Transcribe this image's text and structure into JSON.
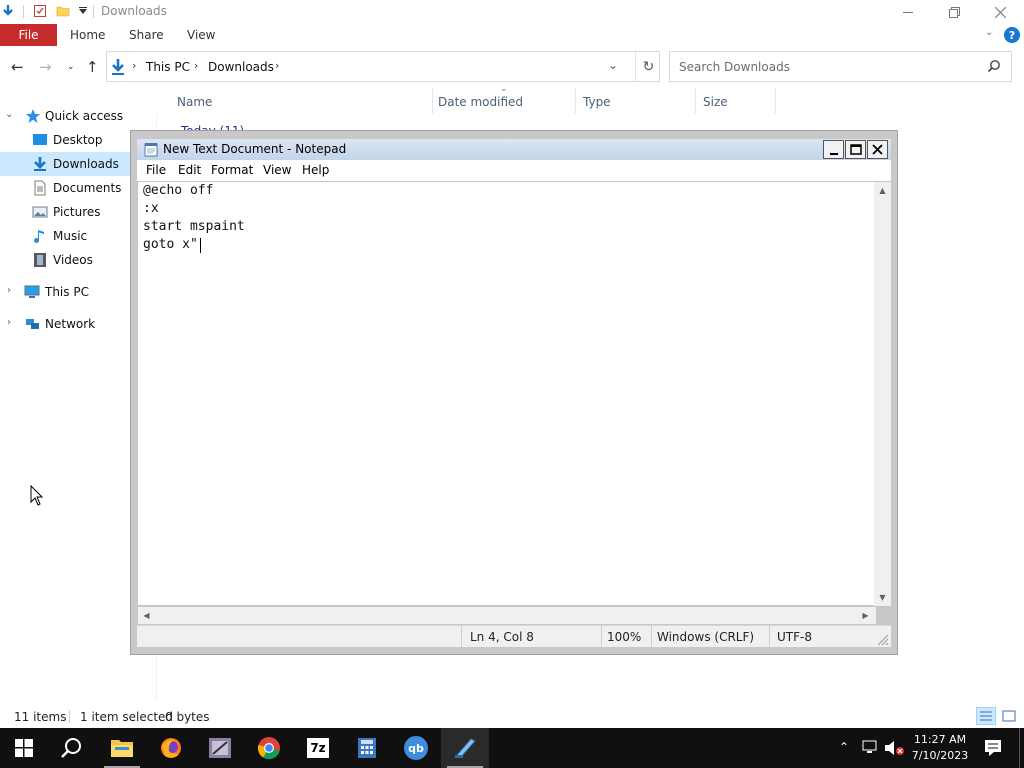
{
  "explorer": {
    "title": "Downloads",
    "ribbon": {
      "file": "File",
      "home": "Home",
      "share": "Share",
      "view": "View"
    },
    "address": {
      "this_pc": "This PC",
      "downloads": "Downloads"
    },
    "search_placeholder": "Search Downloads",
    "nav": {
      "quick_access": "Quick access",
      "desktop": "Desktop",
      "downloads": "Downloads",
      "documents": "Documents",
      "pictures": "Pictures",
      "music": "Music",
      "videos": "Videos",
      "this_pc": "This PC",
      "network": "Network"
    },
    "columns": {
      "name": "Name",
      "date_modified": "Date modified",
      "type": "Type",
      "size": "Size"
    },
    "group_header": "Today (11)",
    "status": {
      "items": "11 items",
      "selected": "1 item selected",
      "bytes": "0 bytes"
    }
  },
  "notepad": {
    "title": "New Text Document - Notepad",
    "menu": {
      "file": "File",
      "edit": "Edit",
      "format": "Format",
      "view": "View",
      "help": "Help"
    },
    "lines": [
      "@echo off",
      ":x",
      "start mspaint",
      "goto x\""
    ],
    "status": {
      "position": "Ln 4, Col 8",
      "zoom": "100%",
      "line_ending": "Windows (CRLF)",
      "encoding": "UTF-8"
    }
  },
  "taskbar": {
    "time": "11:27 AM",
    "date": "7/10/2023",
    "apps": [
      "start-icon",
      "search-icon",
      "file-explorer-icon",
      "firefox-icon",
      "winrar-icon",
      "chrome-icon",
      "7zip-icon",
      "calculator-icon",
      "qbittorrent-icon",
      "notepad-icon"
    ],
    "labels": {
      "sevenzip": "7z",
      "qbittorrent": "qb"
    }
  },
  "colors": {
    "file_tab": "#c42b2b",
    "selection": "#cce8ff",
    "taskbar": "#101010",
    "accent": "#1976d2"
  }
}
